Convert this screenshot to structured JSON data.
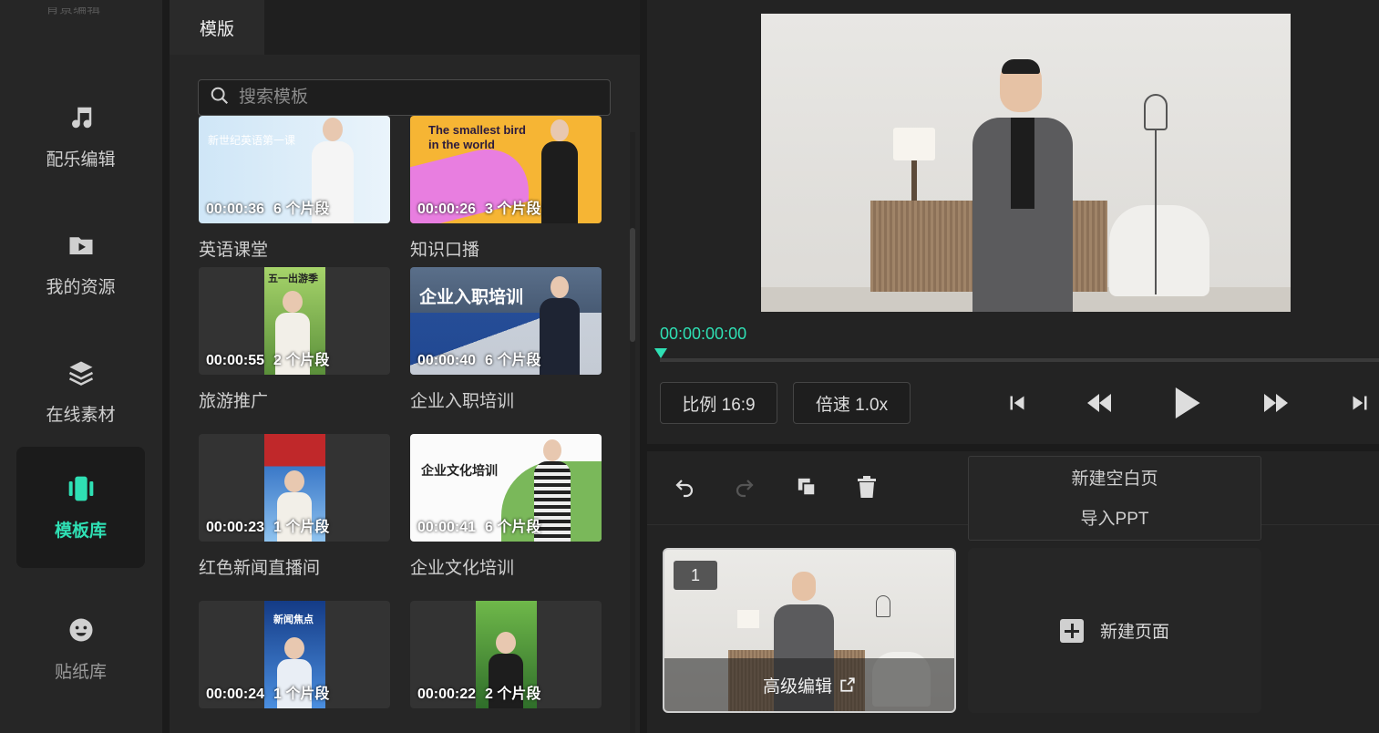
{
  "nav": {
    "top_cut_label": "背景编辑",
    "items": [
      {
        "label": "配乐编辑",
        "icon": "music-note-icon"
      },
      {
        "label": "我的资源",
        "icon": "folder-play-icon"
      },
      {
        "label": "在线素材",
        "icon": "layers-icon"
      },
      {
        "label": "模板库",
        "icon": "template-icon",
        "active": true
      },
      {
        "label": "贴纸库",
        "icon": "smiley-icon"
      }
    ]
  },
  "panel": {
    "tab": "模版",
    "search_placeholder": "搜索模板",
    "cards": [
      {
        "duration": "00:00:36",
        "segments": "6 个片段",
        "name": "英语课堂",
        "overlay": "新世纪英语第一课"
      },
      {
        "duration": "00:00:26",
        "segments": "3 个片段",
        "name": "知识口播",
        "overlay": "The smallest bird in the world"
      },
      {
        "duration": "00:00:55",
        "segments": "2 个片段",
        "name": "旅游推广",
        "overlay": "五一出游季"
      },
      {
        "duration": "00:00:40",
        "segments": "6 个片段",
        "name": "企业入职培训",
        "overlay": "企业入职培训"
      },
      {
        "duration": "00:00:23",
        "segments": "1 个片段",
        "name": "红色新闻直播间",
        "overlay": ""
      },
      {
        "duration": "00:00:41",
        "segments": "6 个片段",
        "name": "企业文化培训",
        "overlay": "企业文化培训"
      },
      {
        "duration": "00:00:24",
        "segments": "1 个片段",
        "name": "",
        "overlay": "新闻焦点"
      },
      {
        "duration": "00:00:22",
        "segments": "2 个片段",
        "name": "",
        "overlay": ""
      }
    ]
  },
  "player": {
    "timecode": "00:00:00:00",
    "ratio_label": "比例 16:9",
    "speed_label": "倍速 1.0x",
    "accent": "#2fe0b4"
  },
  "editor": {
    "menu": [
      "新建空白页",
      "导入PPT"
    ],
    "page_number": "1",
    "advanced_edit": "高级编辑",
    "new_page": "新建页面"
  }
}
